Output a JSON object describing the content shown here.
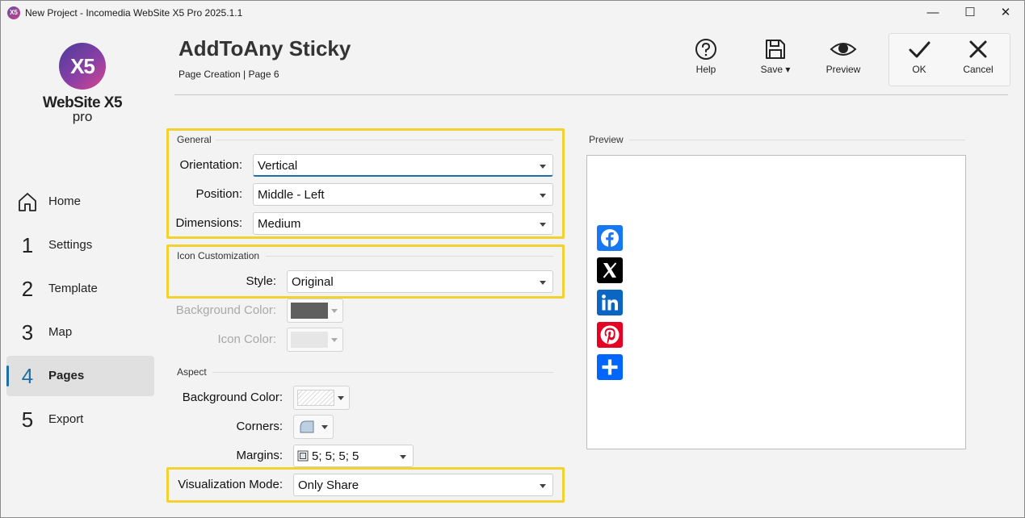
{
  "window": {
    "title": "New Project - Incomedia WebSite X5 Pro 2025.1.1",
    "minimize": "—",
    "maximize": "☐",
    "close": "✕"
  },
  "brand": {
    "logo_mark": "X5",
    "name": "WebSite X5",
    "edition": "pro"
  },
  "nav": [
    {
      "num": "",
      "label": "Home",
      "icon": "home-icon",
      "active": false
    },
    {
      "num": "1",
      "label": "Settings",
      "active": false
    },
    {
      "num": "2",
      "label": "Template",
      "active": false
    },
    {
      "num": "3",
      "label": "Map",
      "active": false
    },
    {
      "num": "4",
      "label": "Pages",
      "active": true
    },
    {
      "num": "5",
      "label": "Export",
      "active": false
    }
  ],
  "header": {
    "title": "AddToAny Sticky",
    "breadcrumb": "Page Creation | Page 6"
  },
  "toolbar": {
    "help_label": "Help",
    "save_label": "Save ▾",
    "preview_label": "Preview",
    "ok_label": "OK",
    "cancel_label": "Cancel"
  },
  "general": {
    "section": "General",
    "orientation_label": "Orientation:",
    "orientation_value": "Vertical",
    "position_label": "Position:",
    "position_value": "Middle - Left",
    "dimensions_label": "Dimensions:",
    "dimensions_value": "Medium"
  },
  "icon_custom": {
    "section": "Icon Customization",
    "style_label": "Style:",
    "style_value": "Original",
    "bg_color_label": "Background Color:",
    "bg_color_value": "#5f5f5f",
    "icon_color_label": "Icon Color:",
    "icon_color_value": "#e6e6e6"
  },
  "aspect": {
    "section": "Aspect",
    "bg_color_label": "Background Color:",
    "corners_label": "Corners:",
    "margins_label": "Margins:",
    "margins_value": "5; 5; 5; 5",
    "vis_mode_label": "Visualization Mode:",
    "vis_mode_value": "Only Share"
  },
  "preview": {
    "section": "Preview",
    "icons": [
      {
        "name": "facebook-icon",
        "color": "#1877f2"
      },
      {
        "name": "x-icon",
        "color": "#000000"
      },
      {
        "name": "linkedin-icon",
        "color": "#0a66c2"
      },
      {
        "name": "pinterest-icon",
        "color": "#e60023"
      },
      {
        "name": "share-icon",
        "color": "#0166ff"
      }
    ]
  },
  "colors": {
    "accent": "#1e6fa6",
    "highlight": "#f2d231"
  }
}
